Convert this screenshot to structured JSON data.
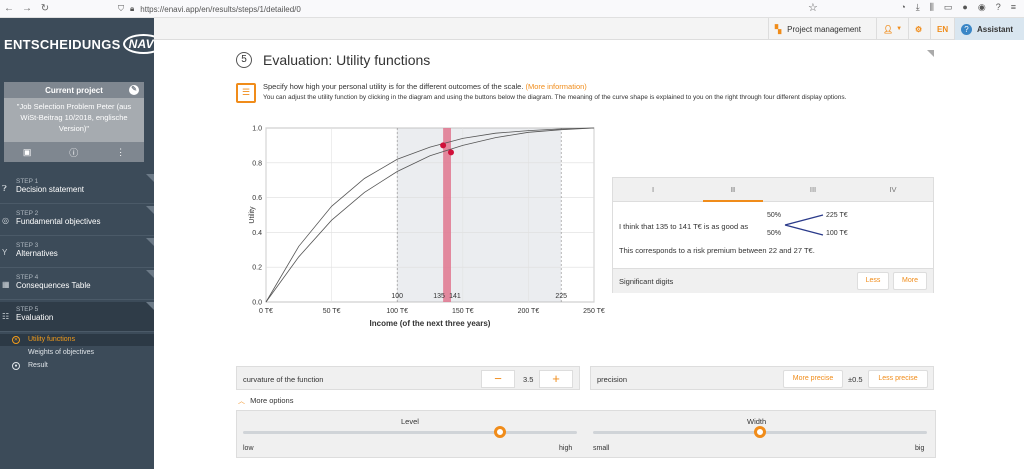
{
  "browser": {
    "url": "https://enavi.app/en/results/steps/1/detailed/0"
  },
  "sidebar": {
    "logo_text": "ENTSCHEIDUNGS",
    "logo_badge": "NAVI",
    "project_header": "Current project",
    "project_name": "\"Job Selection Problem Peter (aus WiSt-Beitrag 10/2018, englische Version)\"",
    "steps": [
      {
        "num": "STEP 1",
        "label": "Decision statement"
      },
      {
        "num": "STEP 2",
        "label": "Fundamental objectives"
      },
      {
        "num": "STEP 3",
        "label": "Alternatives"
      },
      {
        "num": "STEP 4",
        "label": "Consequences Table"
      },
      {
        "num": "STEP 5",
        "label": "Evaluation"
      }
    ],
    "subitems": [
      {
        "label": "Utility functions"
      },
      {
        "label": "Weights of objectives"
      },
      {
        "label": "Result"
      }
    ]
  },
  "topbar": {
    "project_management": "Project management",
    "language": "EN",
    "assistant": "Assistant"
  },
  "main": {
    "step_number": "5",
    "title": "Evaluation: Utility functions",
    "instruction_line1": "Specify how high your personal utility is for the different outcomes of the scale.",
    "more_info": "(More information)",
    "instruction_line2": "You can adjust the utility function by clicking in the diagram and using the buttons below the diagram. The meaning of the curve shape is explained to you on the right through four different display options."
  },
  "chart_data": {
    "type": "line",
    "xlabel": "Income (of the next three years)",
    "ylabel": "Utility",
    "xlim": [
      0,
      250
    ],
    "ylim": [
      0,
      1
    ],
    "x_ticks": [
      "0 T€",
      "50 T€",
      "100 T€",
      "150 T€",
      "200 T€",
      "250 T€"
    ],
    "y_ticks": [
      "0.0",
      "0.2",
      "0.4",
      "0.6",
      "0.8",
      "1.0"
    ],
    "band_range": [
      100,
      225
    ],
    "highlight_range": [
      135,
      141
    ],
    "inline_labels": [
      "100",
      "135",
      "141",
      "225"
    ],
    "series": [
      {
        "x": [
          0,
          25,
          50,
          75,
          100,
          125,
          150,
          175,
          200,
          225,
          250
        ],
        "values": [
          0,
          0.32,
          0.55,
          0.71,
          0.82,
          0.89,
          0.94,
          0.97,
          0.985,
          0.995,
          1.0
        ]
      },
      {
        "x": [
          0,
          25,
          50,
          75,
          100,
          125,
          150,
          175,
          200,
          225,
          250
        ],
        "values": [
          0,
          0.26,
          0.47,
          0.63,
          0.75,
          0.84,
          0.9,
          0.945,
          0.975,
          0.99,
          1.0
        ]
      }
    ],
    "points": [
      {
        "x": 135,
        "y": 0.9
      },
      {
        "x": 141,
        "y": 0.86
      }
    ]
  },
  "panel": {
    "tabs": [
      "I",
      "II",
      "III",
      "IV"
    ],
    "sentence": "I think that 135 to 141 T€ is as good as",
    "prob1": "50%",
    "prob2": "50%",
    "outcome1": "225 T€",
    "outcome2": "100 T€",
    "risk": "This corresponds to a risk premium between 22 and 27 T€.",
    "sig_label": "Significant digits",
    "less": "Less",
    "more": "More"
  },
  "controls": {
    "curvature_label": "curvature of the function",
    "curvature_value": "3.5",
    "minus": "−",
    "plus": "+",
    "precision_label": "precision",
    "more_precise": "More precise",
    "precision_value": "±0.5",
    "less_precise": "Less precise",
    "more_options": "More options",
    "level_label": "Level",
    "level_low": "low",
    "level_high": "high",
    "level_value": 0.77,
    "width_label": "Width",
    "width_small": "small",
    "width_big": "big",
    "width_value": 0.5,
    "accent": "#f08c1a"
  }
}
